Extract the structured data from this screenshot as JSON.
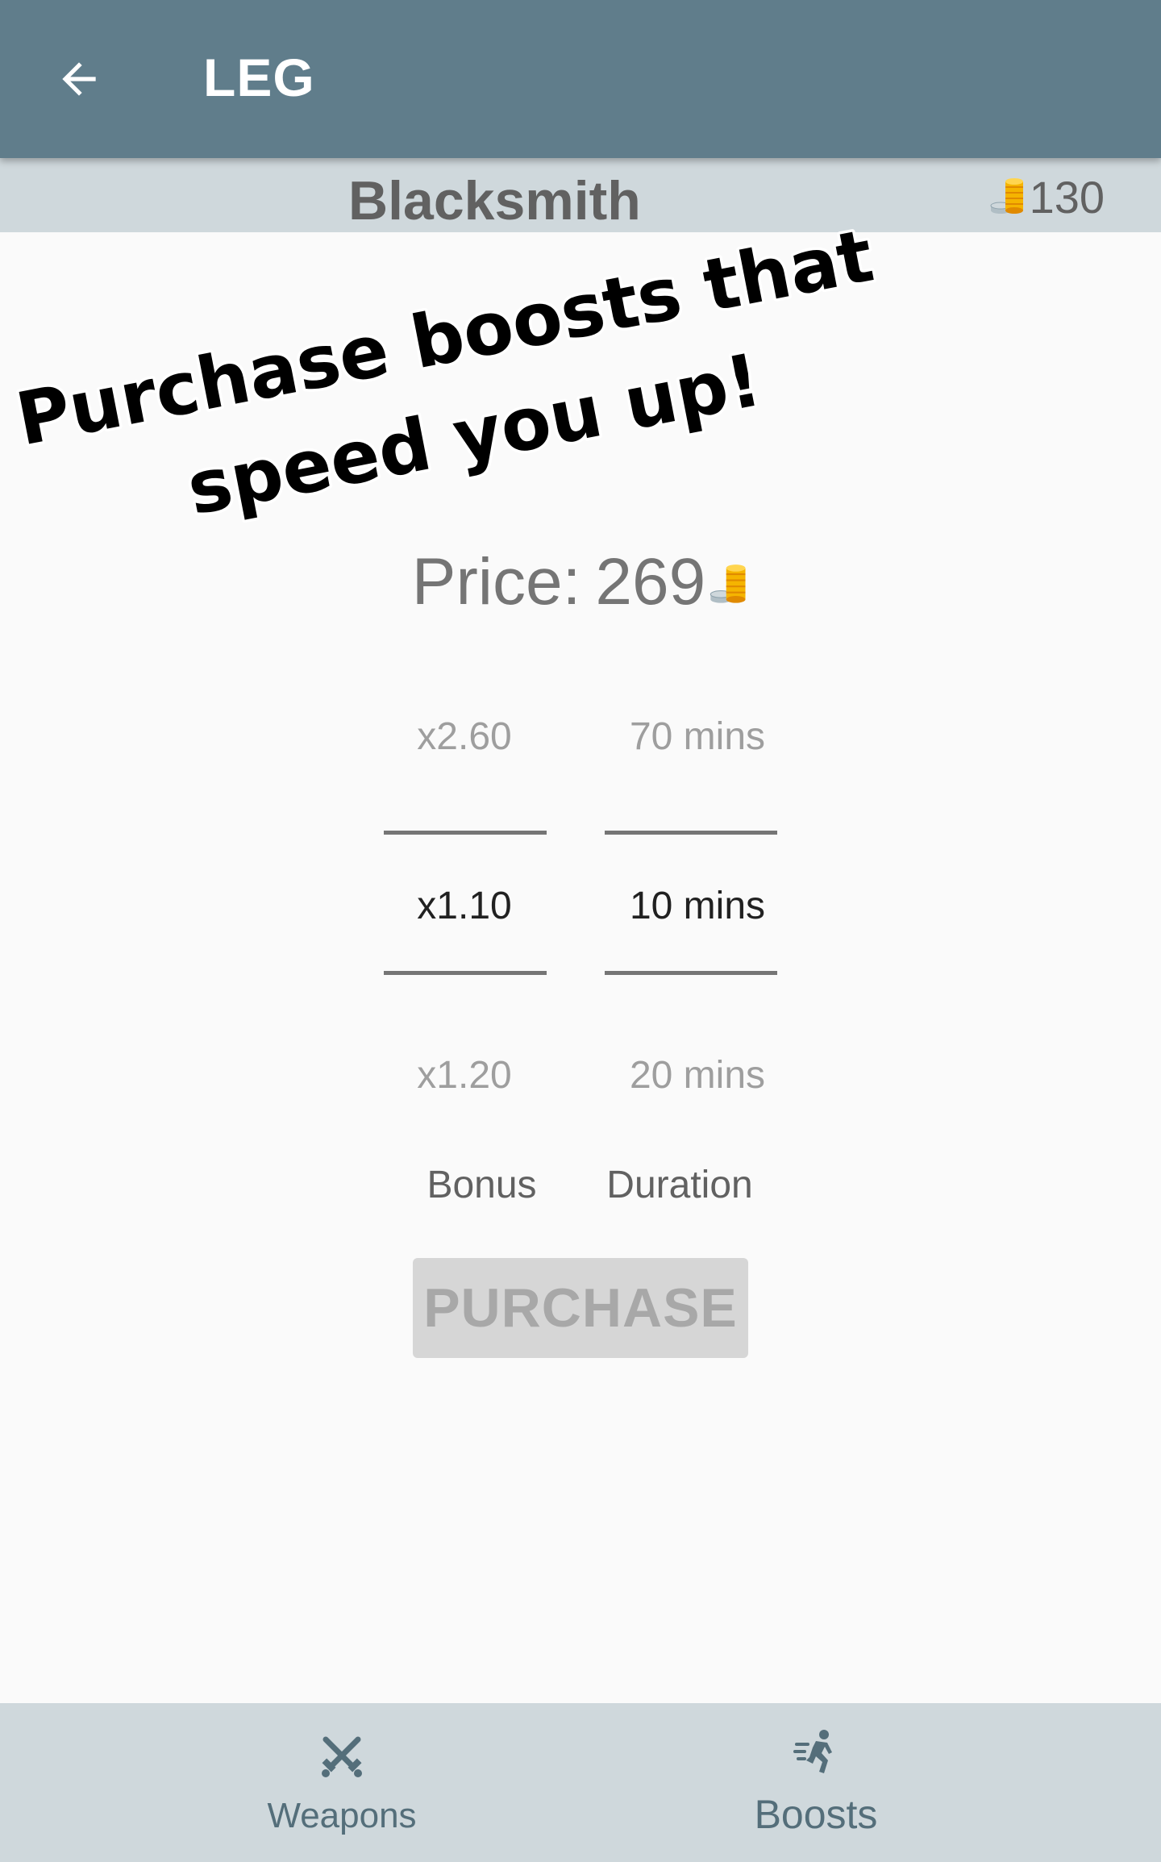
{
  "app_bar": {
    "back_icon": "arrow-left-icon",
    "title": "LEG"
  },
  "shop": {
    "title": "Blacksmith",
    "coin_icon": "coin-stack-icon",
    "balance": "130"
  },
  "promo": {
    "line1": "Purchase boosts that",
    "line2": "speed you up!"
  },
  "price": {
    "label": "Price:",
    "value": "269",
    "coin_icon": "coin-stack-icon"
  },
  "bonus_picker": {
    "above": "x2.60",
    "selected": "x1.10",
    "below": "x1.20",
    "caption": "Bonus"
  },
  "duration_picker": {
    "above": "70 mins",
    "selected": "10 mins",
    "below": "20 mins",
    "caption": "Duration"
  },
  "purchase_button": {
    "label": "PURCHASE",
    "enabled": false
  },
  "bottom_nav": {
    "weapons": {
      "label": "Weapons",
      "icon": "crossed-swords-icon"
    },
    "boosts": {
      "label": "Boosts",
      "icon": "running-person-icon"
    }
  },
  "colors": {
    "app_bar": "#607d8b",
    "header_bg": "#cfd8dc",
    "coin_gold": "#f5b400"
  }
}
